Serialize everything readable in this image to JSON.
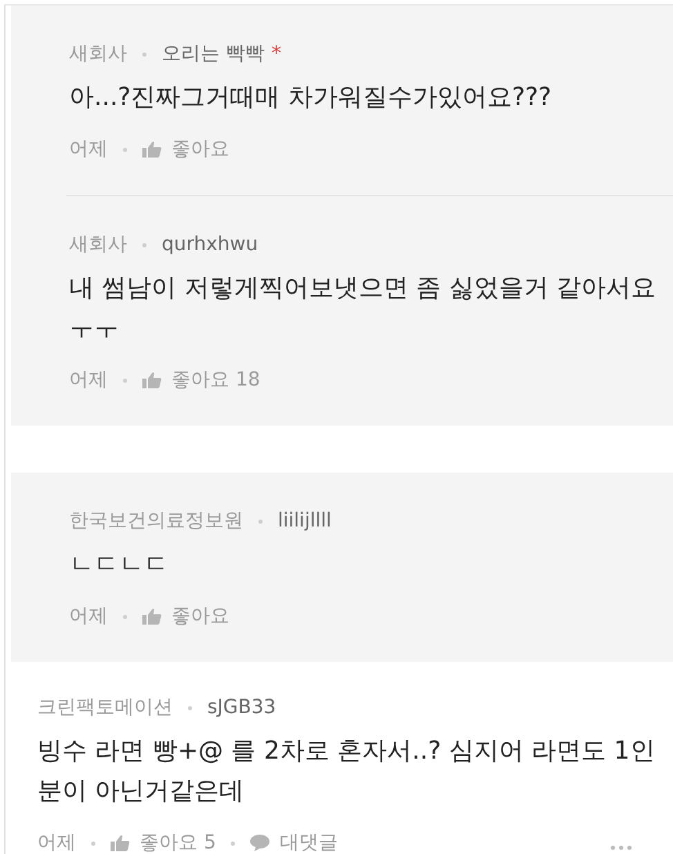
{
  "reply_groups": [
    {
      "replies": [
        {
          "company": "새회사",
          "author": "오리는 빡빡",
          "mark": "*",
          "body": "아...?진짜그거때매 차가워질수가있어요???",
          "time": "어제",
          "likes": "좋아요"
        },
        {
          "company": "새회사",
          "author": "qurhxhwu",
          "body": "내 썸남이 저렇게찍어보냇으면 좀 싫었을거 같아서요ㅜㅜ",
          "time": "어제",
          "likes": "좋아요 18"
        }
      ]
    },
    {
      "replies": [
        {
          "company": "한국보건의료정보원",
          "author": "liilijllll",
          "body": "ㄴㄷㄴㄷ",
          "time": "어제",
          "likes": "좋아요"
        }
      ]
    }
  ],
  "comment": {
    "company": "크린팩토메이션",
    "author": "sJGB33",
    "body": "빙수 라면 빵+@ 를 2차로 혼자서..? 심지어 라면도 1인분이 아닌거같은데",
    "time": "어제",
    "likes": "좋아요 5",
    "reply_label": "대댓글"
  }
}
